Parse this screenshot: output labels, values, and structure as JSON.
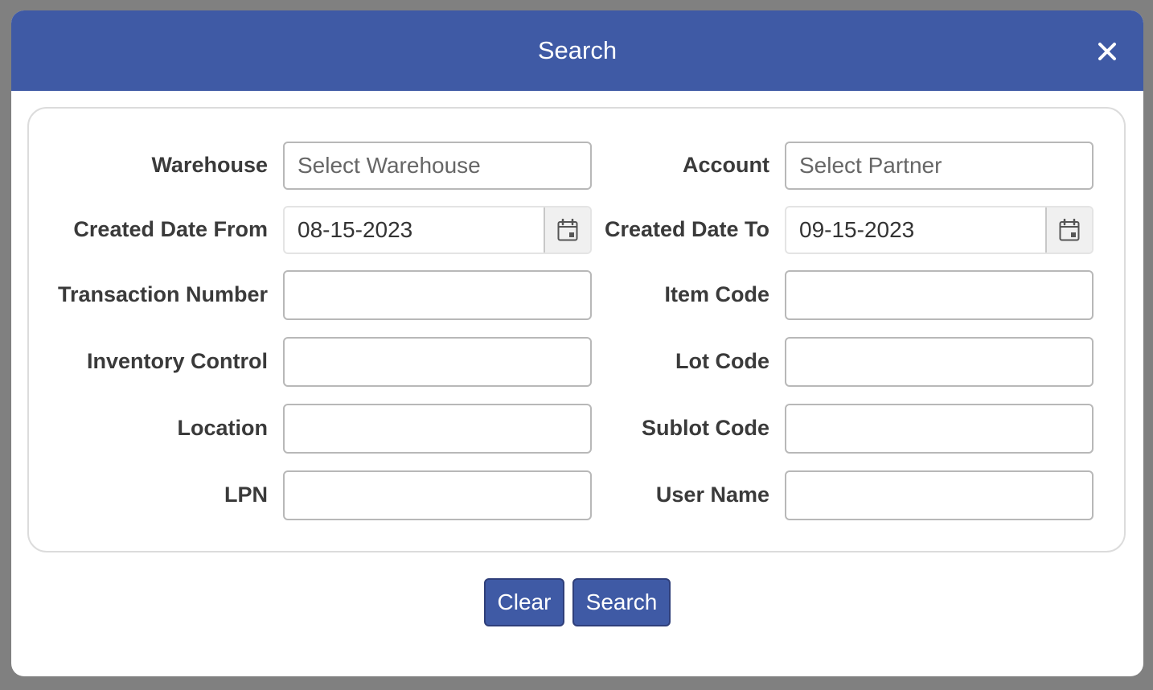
{
  "dialog": {
    "title": "Search",
    "close_icon": "close-icon"
  },
  "fields": {
    "warehouse": {
      "label": "Warehouse",
      "placeholder": "Select Warehouse",
      "value": ""
    },
    "account": {
      "label": "Account",
      "placeholder": "Select Partner",
      "value": ""
    },
    "created_date_from": {
      "label": "Created Date From",
      "value": "08-15-2023",
      "icon": "calendar-icon"
    },
    "created_date_to": {
      "label": "Created Date To",
      "value": "09-15-2023",
      "icon": "calendar-icon"
    },
    "transaction_number": {
      "label": "Transaction Number",
      "value": ""
    },
    "item_code": {
      "label": "Item Code",
      "value": ""
    },
    "inventory_control": {
      "label": "Inventory Control",
      "value": ""
    },
    "lot_code": {
      "label": "Lot Code",
      "value": ""
    },
    "location": {
      "label": "Location",
      "value": ""
    },
    "sublot_code": {
      "label": "Sublot Code",
      "value": ""
    },
    "lpn": {
      "label": "LPN",
      "value": ""
    },
    "user_name": {
      "label": "User Name",
      "value": ""
    }
  },
  "actions": {
    "clear_label": "Clear",
    "search_label": "Search"
  },
  "colors": {
    "header_bg": "#3f5aa5",
    "button_bg": "#3f5aa5",
    "backdrop": "#808080"
  }
}
